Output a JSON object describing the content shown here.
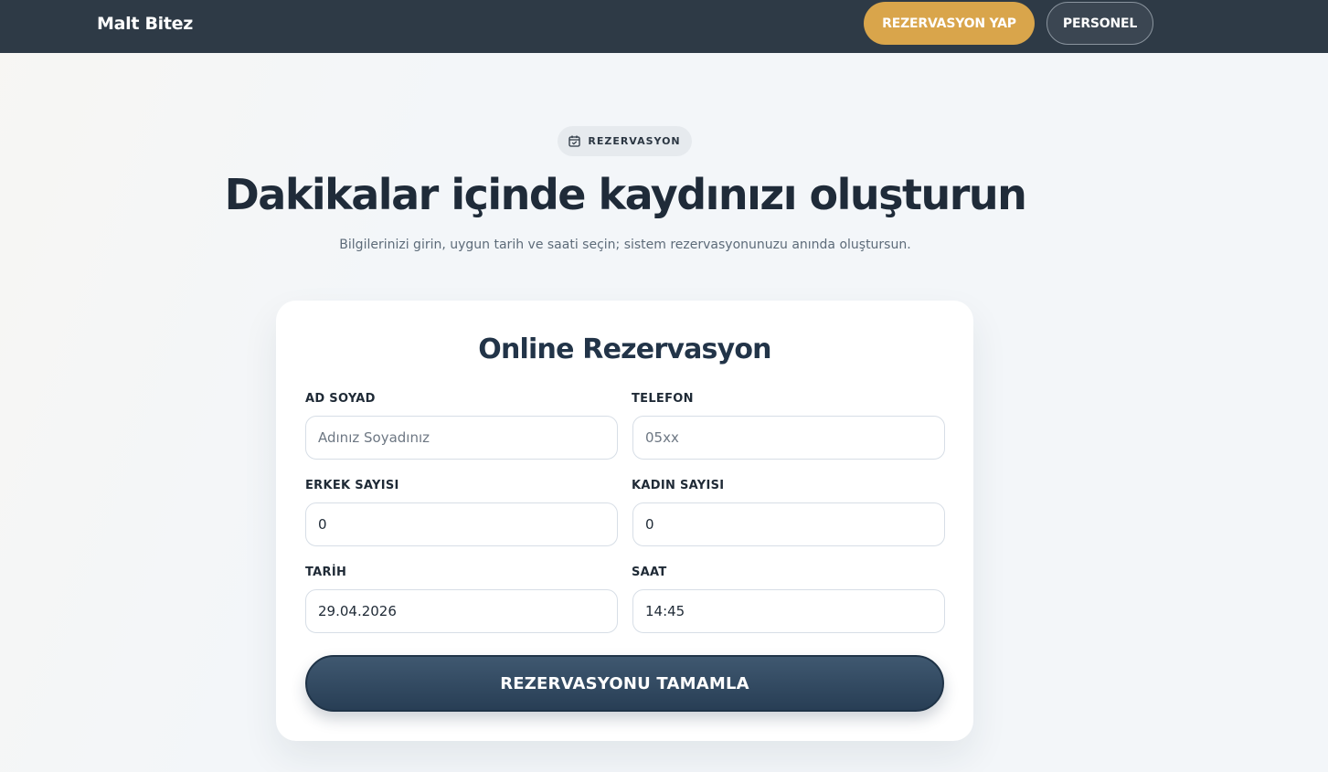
{
  "nav": {
    "brand": "Malt Bitez",
    "reserve_label": "REZERVASYON YAP",
    "staff_label": "PERSONEL"
  },
  "hero": {
    "badge_icon": "calendar-icon",
    "badge_label": "REZERVASYON",
    "title": "Dakikalar içinde kaydınızı oluşturun",
    "subtitle": "Bilgilerinizi girin, uygun tarih ve saati seçin; sistem rezervasyonunuzu anında oluştursun."
  },
  "form": {
    "title": "Online Rezervasyon",
    "name": {
      "label": "AD SOYAD",
      "placeholder": "Adınız Soyadınız",
      "value": ""
    },
    "phone": {
      "label": "TELEFON",
      "placeholder": "05xx",
      "value": ""
    },
    "men": {
      "label": "ERKEK SAYISI",
      "value": "0"
    },
    "women": {
      "label": "KADIN SAYISI",
      "value": "0"
    },
    "date": {
      "label": "TARİH",
      "value": "29.04.2026"
    },
    "time": {
      "label": "SAAT",
      "value": "14:45"
    },
    "submit_label": "REZERVASYONU TAMAMLA"
  },
  "colors": {
    "navbar": "#2e3a46",
    "accent": "#d9a54b",
    "primary": "#2f465e",
    "heading": "#1f2b39"
  }
}
